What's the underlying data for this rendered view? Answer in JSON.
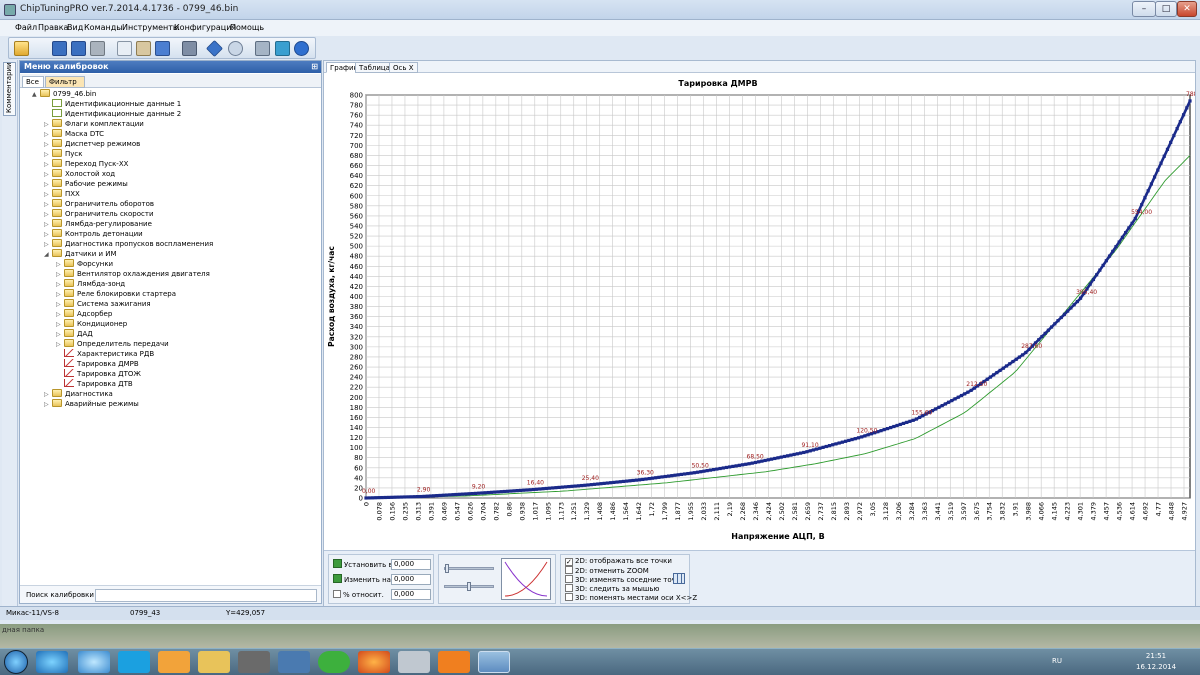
{
  "window": {
    "title": "ChipTuningPRO ver.7.2014.4.1736 - 0799_46.bin",
    "min_label": "–",
    "max_label": "□",
    "close_label": "✕"
  },
  "menu": [
    "Файл",
    "Правка",
    "Вид",
    "Команды",
    "Инструменты",
    "Конфигурация",
    "Помощь"
  ],
  "toolbar": {
    "icons": [
      "open-folder-icon",
      "save-icon",
      "save-as-icon",
      "print-icon",
      "copy-icon",
      "paste-icon",
      "undo-icon",
      "compare-icon",
      "navigate-icon",
      "zoom-icon",
      "tools-icon",
      "settings-icon",
      "help-icon"
    ]
  },
  "left_strip": {
    "comments_label": "Комментарии"
  },
  "left_panel": {
    "header": "Меню калибровок",
    "pin": "⊞",
    "tab_all": "Все",
    "tab_filter": "Фильтр",
    "tree": [
      {
        "label": "0799_46.bin",
        "level": 0,
        "icon": "folder",
        "exp": "▲"
      },
      {
        "label": "Идентификационные данные 1",
        "level": 1,
        "icon": "doc",
        "exp": ""
      },
      {
        "label": "Идентификационные данные 2",
        "level": 1,
        "icon": "doc",
        "exp": ""
      },
      {
        "label": "Флаги комплектации",
        "level": 1,
        "icon": "folder",
        "exp": "▷"
      },
      {
        "label": "Маска DTC",
        "level": 1,
        "icon": "folder",
        "exp": "▷"
      },
      {
        "label": "Диспетчер режимов",
        "level": 1,
        "icon": "folder",
        "exp": "▷"
      },
      {
        "label": "Пуск",
        "level": 1,
        "icon": "folder",
        "exp": "▷"
      },
      {
        "label": "Переход Пуск-XX",
        "level": 1,
        "icon": "folder",
        "exp": "▷"
      },
      {
        "label": "Холостой ход",
        "level": 1,
        "icon": "folder",
        "exp": "▷"
      },
      {
        "label": "Рабочие режимы",
        "level": 1,
        "icon": "folder",
        "exp": "▷"
      },
      {
        "label": "ПХХ",
        "level": 1,
        "icon": "folder",
        "exp": "▷"
      },
      {
        "label": "Ограничитель оборотов",
        "level": 1,
        "icon": "folder",
        "exp": "▷"
      },
      {
        "label": "Ограничитель скорости",
        "level": 1,
        "icon": "folder",
        "exp": "▷"
      },
      {
        "label": "Лямбда-регулирование",
        "level": 1,
        "icon": "folder",
        "exp": "▷"
      },
      {
        "label": "Контроль детонации",
        "level": 1,
        "icon": "folder",
        "exp": "▷"
      },
      {
        "label": "Диагностика пропусков воспламенения",
        "level": 1,
        "icon": "folder",
        "exp": "▷"
      },
      {
        "label": "Датчики и ИМ",
        "level": 1,
        "icon": "folder",
        "exp": "◢"
      },
      {
        "label": "Форсунки",
        "level": 2,
        "icon": "folder",
        "exp": "▷"
      },
      {
        "label": "Вентилятор охлаждения двигателя",
        "level": 2,
        "icon": "folder",
        "exp": "▷"
      },
      {
        "label": "Лямбда-зонд",
        "level": 2,
        "icon": "folder",
        "exp": "▷"
      },
      {
        "label": "Реле блокировки стартера",
        "level": 2,
        "icon": "folder",
        "exp": "▷"
      },
      {
        "label": "Система зажигания",
        "level": 2,
        "icon": "folder",
        "exp": "▷"
      },
      {
        "label": "Адсорбер",
        "level": 2,
        "icon": "folder",
        "exp": "▷"
      },
      {
        "label": "Кондиционер",
        "level": 2,
        "icon": "folder",
        "exp": "▷"
      },
      {
        "label": "ДАД",
        "level": 2,
        "icon": "folder",
        "exp": "▷"
      },
      {
        "label": "Определитель передачи",
        "level": 2,
        "icon": "folder",
        "exp": "▷"
      },
      {
        "label": "Характеристика РДВ",
        "level": 2,
        "icon": "chart",
        "exp": ""
      },
      {
        "label": "Тарировка ДМРВ",
        "level": 2,
        "icon": "chart",
        "exp": ""
      },
      {
        "label": "Тарировка ДТОЖ",
        "level": 2,
        "icon": "chart",
        "exp": ""
      },
      {
        "label": "Тарировка ДТВ",
        "level": 2,
        "icon": "chart",
        "exp": ""
      },
      {
        "label": "Диагностика",
        "level": 1,
        "icon": "folder",
        "exp": "▷"
      },
      {
        "label": "Аварийные режимы",
        "level": 1,
        "icon": "folder",
        "exp": "▷"
      }
    ],
    "search_label": "Поиск калибровки",
    "search_value": ""
  },
  "status": {
    "ecu": "Микас-11/VS-8",
    "file": "0799_43",
    "cursor": "Y=429,057"
  },
  "right_panel": {
    "tab_graph": "График",
    "tab_table": "Таблица",
    "tab_axis": "Ось X"
  },
  "controls": {
    "set_label": "Установить в",
    "set_value": "0,000",
    "change_label": "Изменить на",
    "change_value": "0,000",
    "percent_label": "%",
    "relative_label": "относит.",
    "relative_value": "0,000",
    "options": [
      {
        "label": "2D: отображать все точки",
        "checked": true
      },
      {
        "label": "2D: отменить ZOOM",
        "checked": false
      },
      {
        "label": "3D: изменять соседние точки",
        "checked": false
      },
      {
        "label": "3D: следить за мышью",
        "checked": false
      },
      {
        "label": "3D: поменять местами оси X<>Z",
        "checked": false
      }
    ],
    "grid_icon": "table-grid-icon"
  },
  "behind_window": {
    "label": "дная папка"
  },
  "taskbar": {
    "lang": "RU",
    "time": "21:51",
    "date": "16.12.2014"
  },
  "chart_data": {
    "type": "line",
    "title": "Тарировка ДМРВ",
    "xlabel": "Напряжение АЦП, В",
    "ylabel": "Расход воздуха, кг/час",
    "ylim": [
      0,
      800
    ],
    "xlim": [
      0,
      4.99
    ],
    "y_ticks": [
      0,
      20,
      40,
      60,
      80,
      100,
      120,
      140,
      160,
      180,
      200,
      220,
      240,
      260,
      280,
      300,
      320,
      340,
      360,
      380,
      400,
      420,
      440,
      460,
      480,
      500,
      520,
      540,
      560,
      580,
      600,
      620,
      640,
      660,
      680,
      700,
      720,
      740,
      760,
      780,
      800
    ],
    "x_tick_labels": [
      "0",
      "0,078",
      "0,156",
      "0,235",
      "0,313",
      "0,391",
      "0,469",
      "0,547",
      "0,626",
      "0,704",
      "0,782",
      "0,86",
      "0,938",
      "1,017",
      "1,095",
      "1,173",
      "1,251",
      "1,329",
      "1,408",
      "1,486",
      "1,564",
      "1,642",
      "1,72",
      "1,799",
      "1,877",
      "1,955",
      "2,033",
      "2,111",
      "2,19",
      "2,268",
      "2,346",
      "2,424",
      "2,502",
      "2,581",
      "2,659",
      "2,737",
      "2,815",
      "2,893",
      "2,972",
      "3,05",
      "3,128",
      "3,206",
      "3,284",
      "3,363",
      "3,441",
      "3,519",
      "3,597",
      "3,675",
      "3,754",
      "3,832",
      "3,91",
      "3,988",
      "4,066",
      "4,145",
      "4,223",
      "4,301",
      "4,379",
      "4,457",
      "4,536",
      "4,614",
      "4,692",
      "4,77",
      "4,848",
      "4,927"
    ],
    "point_labels": [
      {
        "x": 0.0,
        "y": 0.0,
        "text": "0,00"
      },
      {
        "x": 0.55,
        "y": 2.9,
        "text": "2,90"
      },
      {
        "x": 1.1,
        "y": 9.2,
        "text": "9,20"
      },
      {
        "x": 1.65,
        "y": 16.4,
        "text": "16,40"
      },
      {
        "x": 2.2,
        "y": 25.4,
        "text": "25,40"
      },
      {
        "x": 2.75,
        "y": 36.3,
        "text": "36,30"
      },
      {
        "x": 3.3,
        "y": 50.5,
        "text": "50,50"
      },
      {
        "x": 3.85,
        "y": 68.5,
        "text": "68,50"
      },
      {
        "x": 4.4,
        "y": 91.1,
        "text": "91,10"
      },
      {
        "x": 4.95,
        "y": 120.5,
        "text": "120,50"
      },
      {
        "x": 5.5,
        "y": 155.6,
        "text": "155,60"
      },
      {
        "x": 6.05,
        "y": 212.5,
        "text": "212,50"
      },
      {
        "x": 6.6,
        "y": 287.6,
        "text": "287,60"
      },
      {
        "x": 7.15,
        "y": 395.4,
        "text": "395,40"
      },
      {
        "x": 7.7,
        "y": 554.0,
        "text": "554,00"
      },
      {
        "x": 8.25,
        "y": 788.2,
        "text": "788,20"
      }
    ],
    "series": [
      {
        "name": "",
        "color": "#1a2a8a",
        "style": "markers",
        "points_x": [
          0,
          0.55,
          1.1,
          1.65,
          2.2,
          2.75,
          3.3,
          3.85,
          4.4,
          4.95,
          5.5,
          6.05,
          6.6,
          7.15,
          7.7,
          8.25
        ],
        "points_y": [
          0,
          2.9,
          9.2,
          16.4,
          25.4,
          36.3,
          50.5,
          68.5,
          91.1,
          120.5,
          155.6,
          212.5,
          287.6,
          395.4,
          554.0,
          788.2
        ]
      },
      {
        "name": "",
        "color": "#2e9b2e",
        "style": "line",
        "points_x": [
          0,
          1,
          2,
          3,
          4,
          4.5,
          5,
          5.5,
          6,
          6.5,
          7,
          7.5,
          8,
          8.25
        ],
        "points_y": [
          0,
          4,
          14,
          30,
          52,
          68,
          88,
          118,
          170,
          250,
          370,
          490,
          630,
          680
        ]
      }
    ],
    "grid": true,
    "legend": "none"
  }
}
